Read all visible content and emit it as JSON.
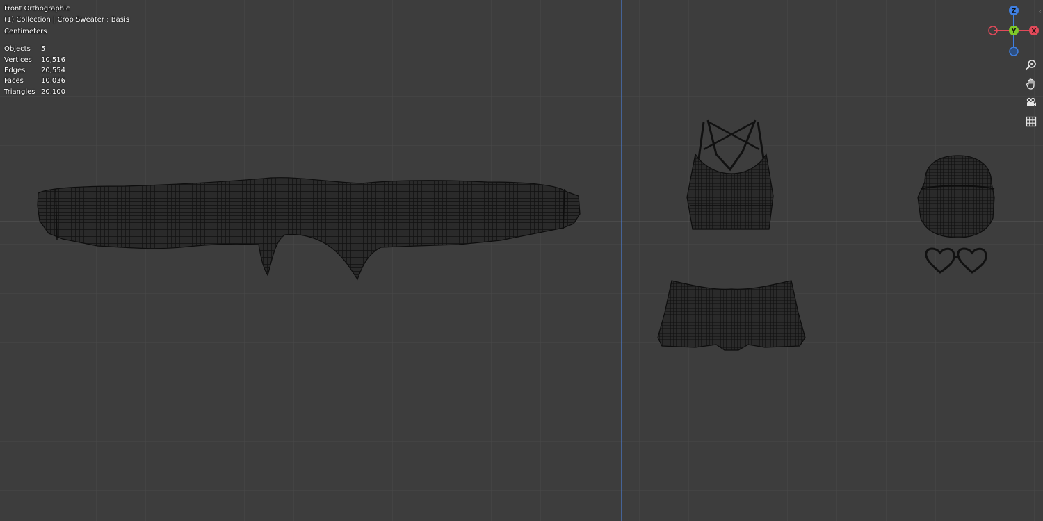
{
  "viewport": {
    "view_name": "Front Orthographic",
    "collection_info": "(1) Collection | Crop Sweater : Basis",
    "units": "Centimeters",
    "background_color": "#3d3d3d",
    "grid_color": "#4b4b4b",
    "z_axis_line_color": "#4a78c8"
  },
  "stats": [
    {
      "label": "Objects",
      "value": "5"
    },
    {
      "label": "Vertices",
      "value": "10,516"
    },
    {
      "label": "Edges",
      "value": "20,554"
    },
    {
      "label": "Faces",
      "value": "10,036"
    },
    {
      "label": "Triangles",
      "value": "20,100"
    }
  ],
  "gizmo": {
    "z_label": "Z",
    "y_label": "Y",
    "x_label": "X",
    "z_color": "#3f7fe0",
    "y_color": "#7fc92a",
    "x_color": "#e24a5a"
  },
  "nav_tools": [
    {
      "icon": "zoom-icon"
    },
    {
      "icon": "pan-hand-icon"
    },
    {
      "icon": "camera-icon"
    },
    {
      "icon": "grid-icon"
    }
  ],
  "objects": [
    "crop-sweater",
    "sports-bra",
    "shorts",
    "beanie",
    "heart-sunglasses"
  ]
}
